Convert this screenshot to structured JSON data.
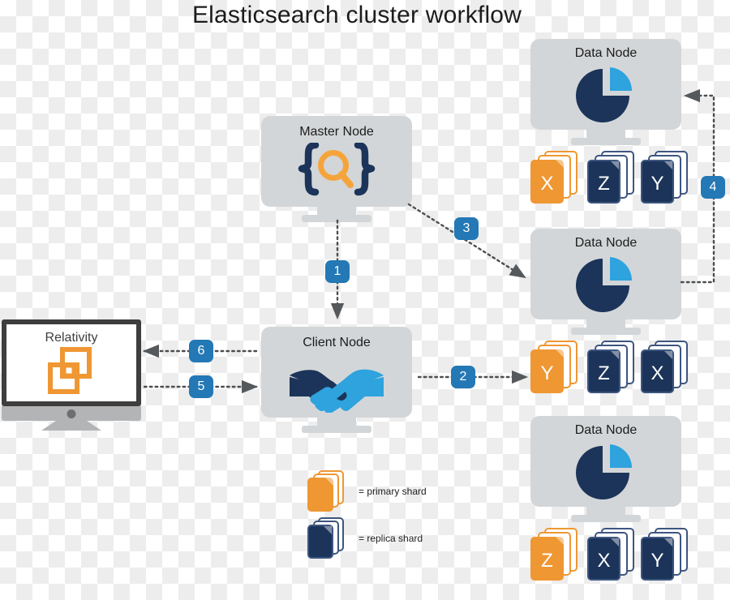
{
  "title": "Elasticsearch cluster workflow",
  "colors": {
    "primary_shard": "#ef9733",
    "replica_shard": "#1c3459",
    "node_body": "#d3d6d8",
    "badge_blue": "#2378b5",
    "accent_light_blue": "#2ea3de",
    "relativity_orange": "#ef9733",
    "bezel_dark": "#3e3e3e"
  },
  "nodes": {
    "master": {
      "label": "Master Node",
      "icon": "braces-magnifier-icon"
    },
    "client": {
      "label": "Client Node",
      "icon": "handshake-icon"
    },
    "data1": {
      "label": "Data Node",
      "icon": "pie-chart-icon"
    },
    "data2": {
      "label": "Data Node",
      "icon": "pie-chart-icon"
    },
    "data3": {
      "label": "Data Node",
      "icon": "pie-chart-icon"
    }
  },
  "client_app": {
    "label": "Relativity",
    "icon": "overlapping-squares-icon"
  },
  "shard_rows": [
    {
      "row": "data-node-1-shards",
      "shards": [
        {
          "letter": "X",
          "type": "primary"
        },
        {
          "letter": "Z",
          "type": "replica"
        },
        {
          "letter": "Y",
          "type": "replica"
        }
      ]
    },
    {
      "row": "data-node-2-shards",
      "shards": [
        {
          "letter": "Y",
          "type": "primary"
        },
        {
          "letter": "Z",
          "type": "replica"
        },
        {
          "letter": "X",
          "type": "replica"
        }
      ]
    },
    {
      "row": "data-node-3-shards",
      "shards": [
        {
          "letter": "Z",
          "type": "primary"
        },
        {
          "letter": "X",
          "type": "replica"
        },
        {
          "letter": "Y",
          "type": "replica"
        }
      ]
    }
  ],
  "legend": [
    {
      "swatch": "primary",
      "text": "= primary shard"
    },
    {
      "swatch": "replica",
      "text": "= replica shard"
    }
  ],
  "steps": [
    {
      "number": "1",
      "from": "master-node",
      "to": "client-node"
    },
    {
      "number": "2",
      "from": "client-node",
      "to": "data-node-2-shards"
    },
    {
      "number": "3",
      "from": "master-node",
      "to": "data-node-2"
    },
    {
      "number": "4",
      "from": "data-node-2",
      "to": "data-node-1"
    },
    {
      "number": "5",
      "from": "relativity",
      "to": "client-node"
    },
    {
      "number": "6",
      "from": "client-node",
      "to": "relativity"
    }
  ]
}
